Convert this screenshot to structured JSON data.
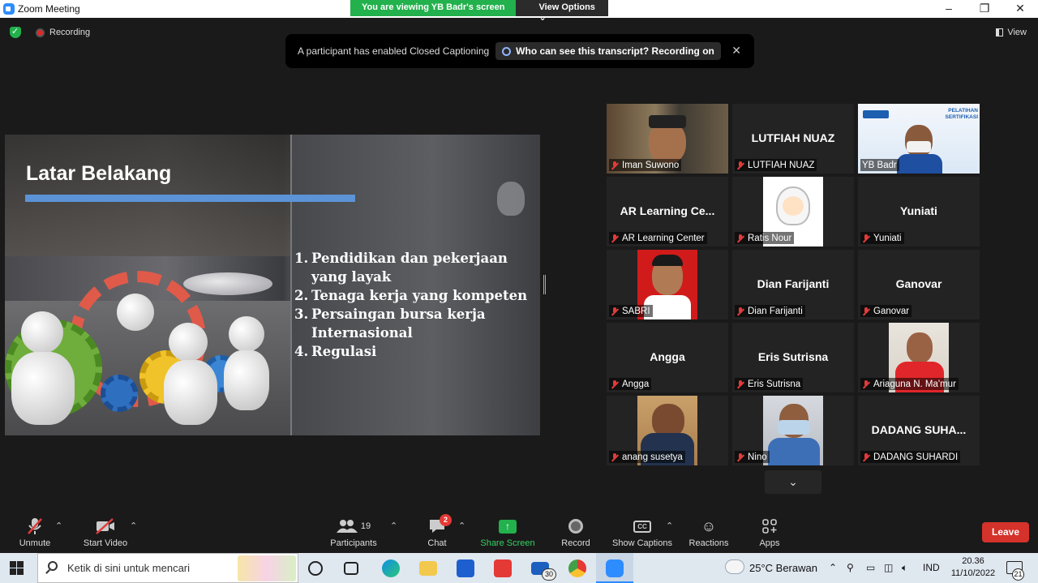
{
  "window": {
    "title": "Zoom Meeting",
    "controls": [
      "–",
      "❐",
      "✕"
    ]
  },
  "banner": {
    "viewing_text": "You are viewing YB Badr's screen",
    "view_options": "View Options ⌄"
  },
  "topbar": {
    "recording_label": "Recording",
    "view_label": "View"
  },
  "caption_notice": {
    "text": "A participant has enabled Closed Captioning",
    "who_text": "Who can see this transcript? Recording on",
    "close": "✕"
  },
  "slide": {
    "title": "Latar Belakang",
    "items": [
      {
        "num": "1.",
        "text": "Pendidikan dan pekerjaan"
      },
      {
        "num": "",
        "text": "yang layak"
      },
      {
        "num": "2.",
        "text": "Tenaga kerja yang kompeten"
      },
      {
        "num": "3.",
        "text": "Persaingan bursa kerja"
      },
      {
        "num": "",
        "text": "Internasional"
      },
      {
        "num": "4.",
        "text": "Regulasi"
      }
    ]
  },
  "gallery": [
    {
      "label": "Iman Suwono",
      "big": ""
    },
    {
      "label": "LUTFIAH NUAZ",
      "big": "LUTFIAH NUAZ"
    },
    {
      "label": "YB Badr",
      "big": "",
      "logo_text": "PELATIHAN SERTIFIKASI"
    },
    {
      "label": "AR Learning Center",
      "big": "AR Learning Ce..."
    },
    {
      "label": "Ratis Nour",
      "big": ""
    },
    {
      "label": "Yuniati",
      "big": "Yuniati"
    },
    {
      "label": "SABRI",
      "big": ""
    },
    {
      "label": "Dian Farijanti",
      "big": "Dian Farijanti"
    },
    {
      "label": "Ganovar",
      "big": "Ganovar"
    },
    {
      "label": "Angga",
      "big": "Angga"
    },
    {
      "label": "Eris Sutrisna",
      "big": "Eris Sutrisna"
    },
    {
      "label": "Ariaguna N. Ma'mur",
      "big": ""
    },
    {
      "label": "anang susetya",
      "big": ""
    },
    {
      "label": "Nino",
      "big": ""
    },
    {
      "label": "DADANG SUHARDI",
      "big": "DADANG SUHA..."
    }
  ],
  "toolbar": {
    "unmute": "Unmute",
    "start_video": "Start Video",
    "participants": "Participants",
    "participants_count": "19",
    "chat": "Chat",
    "chat_badge": "2",
    "share_screen": "Share Screen",
    "record": "Record",
    "show_captions": "Show Captions",
    "reactions": "Reactions",
    "apps": "Apps",
    "leave": "Leave"
  },
  "taskbar": {
    "search_placeholder": "Ketik di sini untuk mencari",
    "mail_badge": "30",
    "weather": "25°C  Berawan",
    "language": "IND",
    "time": "20.36",
    "date": "11/10/2022",
    "notifications": "21"
  },
  "colors": {
    "share_green": "#22b14c",
    "leave_red": "#d4322b",
    "active_speaker": "#f0e64a",
    "slide_accent": "#5b93d6"
  }
}
